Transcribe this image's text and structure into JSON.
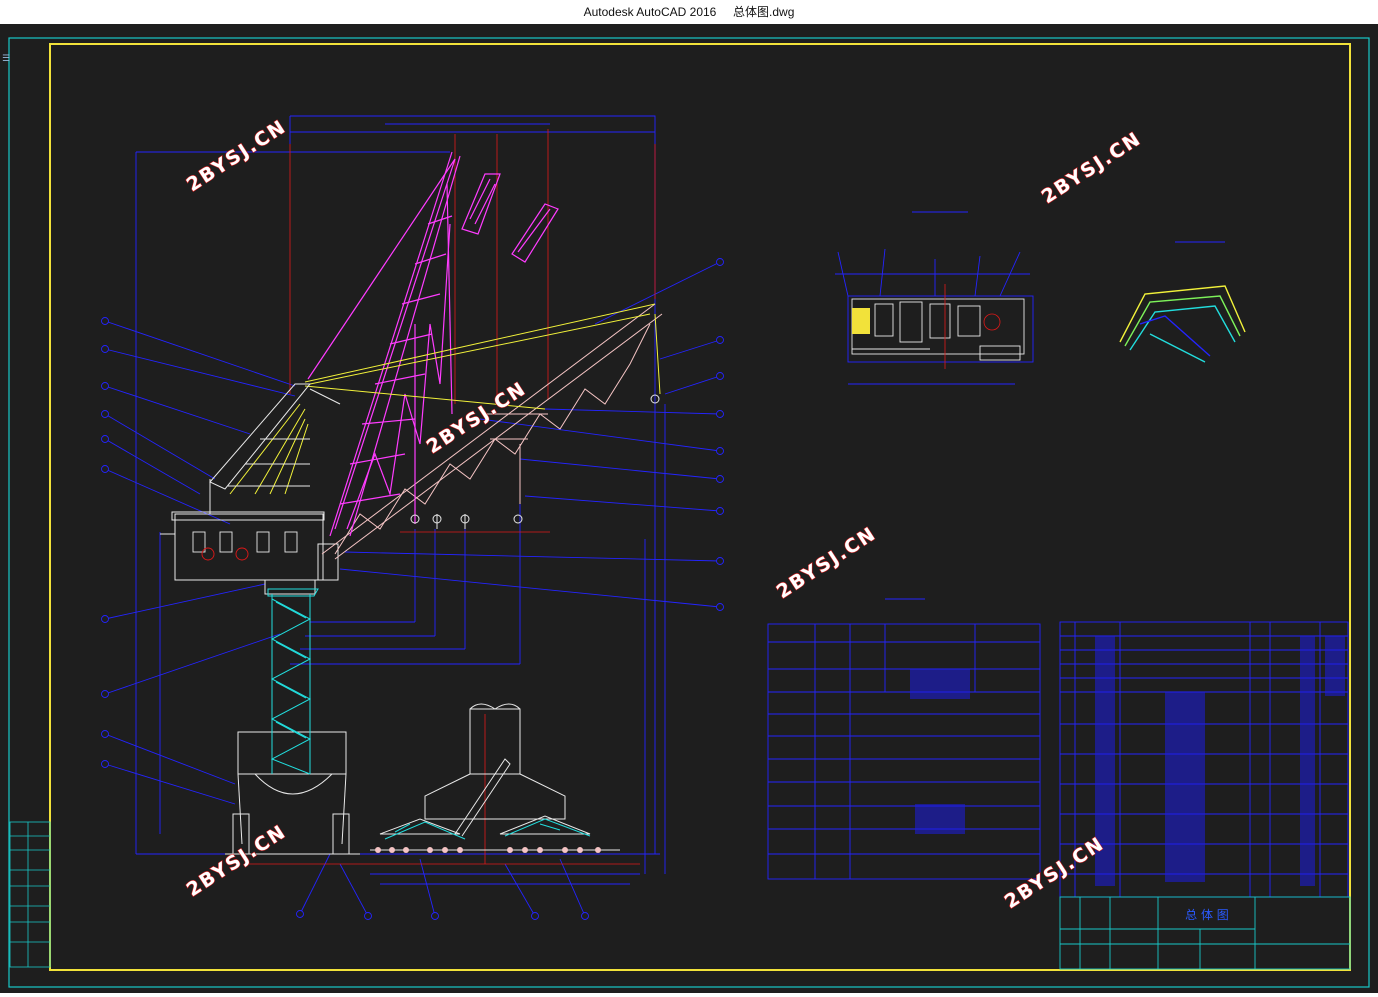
{
  "window": {
    "app_name": "Autodesk AutoCAD 2016",
    "file_name": "总体图.dwg"
  },
  "drawing": {
    "watermark": "2BYSJ.CN",
    "title_block_name": "总 体 图",
    "colors": {
      "background": "#1e1e1e",
      "frame_outer": "#18c8c8",
      "frame_inner": "#f2e23a",
      "tower": "#ff3cff",
      "boom": "#f5c4c4",
      "dimension": "#2424ff",
      "ladder": "#22dddd",
      "center_line": "#e01818",
      "cable": "#f2f23a",
      "structure": "#e8e8e8"
    }
  }
}
